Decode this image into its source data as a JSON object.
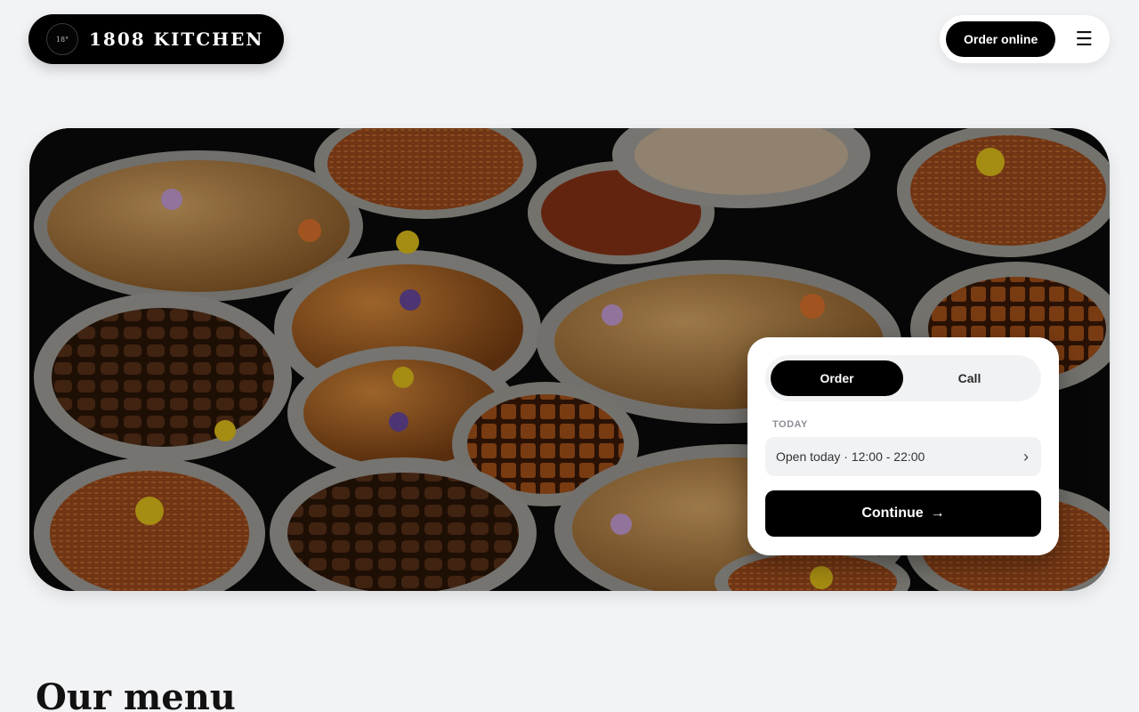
{
  "brand": {
    "logo_text": "18°",
    "name": "1808 KITCHEN"
  },
  "nav": {
    "order_online_label": "Order online",
    "menu_icon": "hamburger-icon"
  },
  "hero": {
    "image_icon": "food-spread-image"
  },
  "order_card": {
    "tabs": [
      {
        "label": "Order",
        "active": true
      },
      {
        "label": "Call",
        "active": false
      }
    ],
    "today_label": "TODAY",
    "hours_text": "Open today · 12:00 - 22:00",
    "continue_label": "Continue"
  },
  "section": {
    "heading": "Our menu"
  },
  "colors": {
    "page_bg": "#f2f3f5",
    "primary": "#000000",
    "card_bg": "#ffffff",
    "muted": "#8b8f96"
  }
}
